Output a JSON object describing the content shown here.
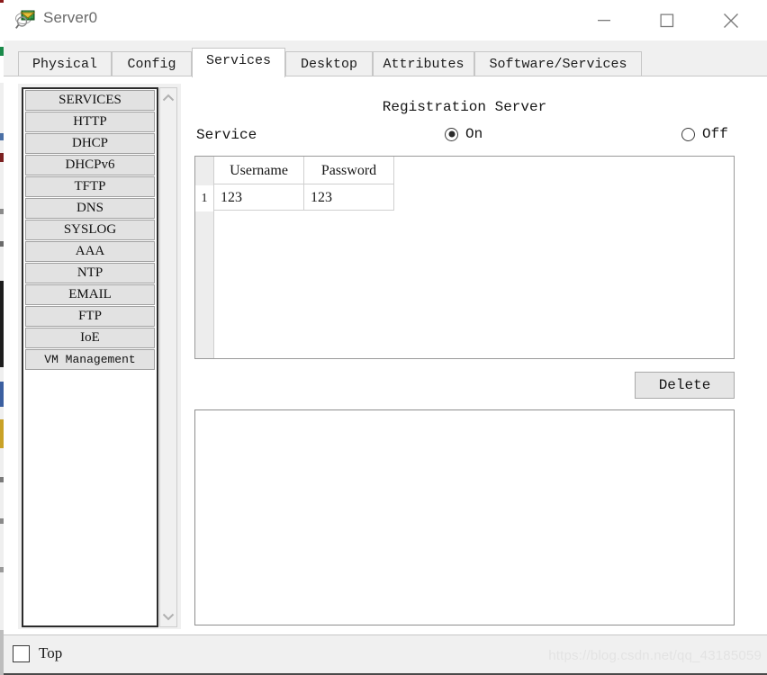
{
  "window": {
    "title": "Server0",
    "icon": "packet-tracer-device-icon",
    "controls": {
      "minimize": "minimize-icon",
      "maximize": "maximize-icon",
      "close": "close-icon"
    }
  },
  "tabs": [
    {
      "label": "Physical",
      "active": false
    },
    {
      "label": "Config",
      "active": false
    },
    {
      "label": "Services",
      "active": true
    },
    {
      "label": "Desktop",
      "active": false
    },
    {
      "label": "Attributes",
      "active": false
    },
    {
      "label": "Software/Services",
      "active": false
    }
  ],
  "sidebar": {
    "items": [
      {
        "label": "SERVICES",
        "mono": false
      },
      {
        "label": "HTTP",
        "mono": false
      },
      {
        "label": "DHCP",
        "mono": false
      },
      {
        "label": "DHCPv6",
        "mono": false
      },
      {
        "label": "TFTP",
        "mono": false
      },
      {
        "label": "DNS",
        "mono": false
      },
      {
        "label": "SYSLOG",
        "mono": false
      },
      {
        "label": "AAA",
        "mono": false
      },
      {
        "label": "NTP",
        "mono": false
      },
      {
        "label": "EMAIL",
        "mono": false
      },
      {
        "label": "FTP",
        "mono": false
      },
      {
        "label": "IoE",
        "mono": false
      },
      {
        "label": "VM Management",
        "mono": true
      }
    ],
    "scrollbar": {
      "up_icon": "chevron-up-icon",
      "down_icon": "chevron-down-icon"
    }
  },
  "pane": {
    "title": "Registration Server",
    "service_label": "Service",
    "radios": [
      {
        "label": "On",
        "checked": true
      },
      {
        "label": "Off",
        "checked": false
      }
    ],
    "table": {
      "columns": [
        "Username",
        "Password"
      ],
      "rows": [
        {
          "index": "1",
          "username": "123",
          "password": "123"
        }
      ]
    },
    "delete_label": "Delete",
    "output_text": ""
  },
  "footer": {
    "top_label": "Top",
    "top_checked": false,
    "watermark": "https://blog.csdn.net/qq_43185059"
  },
  "colors": {
    "chrome": "#f0f0f0",
    "panel_border": "#c6c6c6",
    "list_border": "#2b2b2b",
    "button_face": "#e2e2e2",
    "text": "#161616",
    "watermark": "#e3e3e3"
  }
}
